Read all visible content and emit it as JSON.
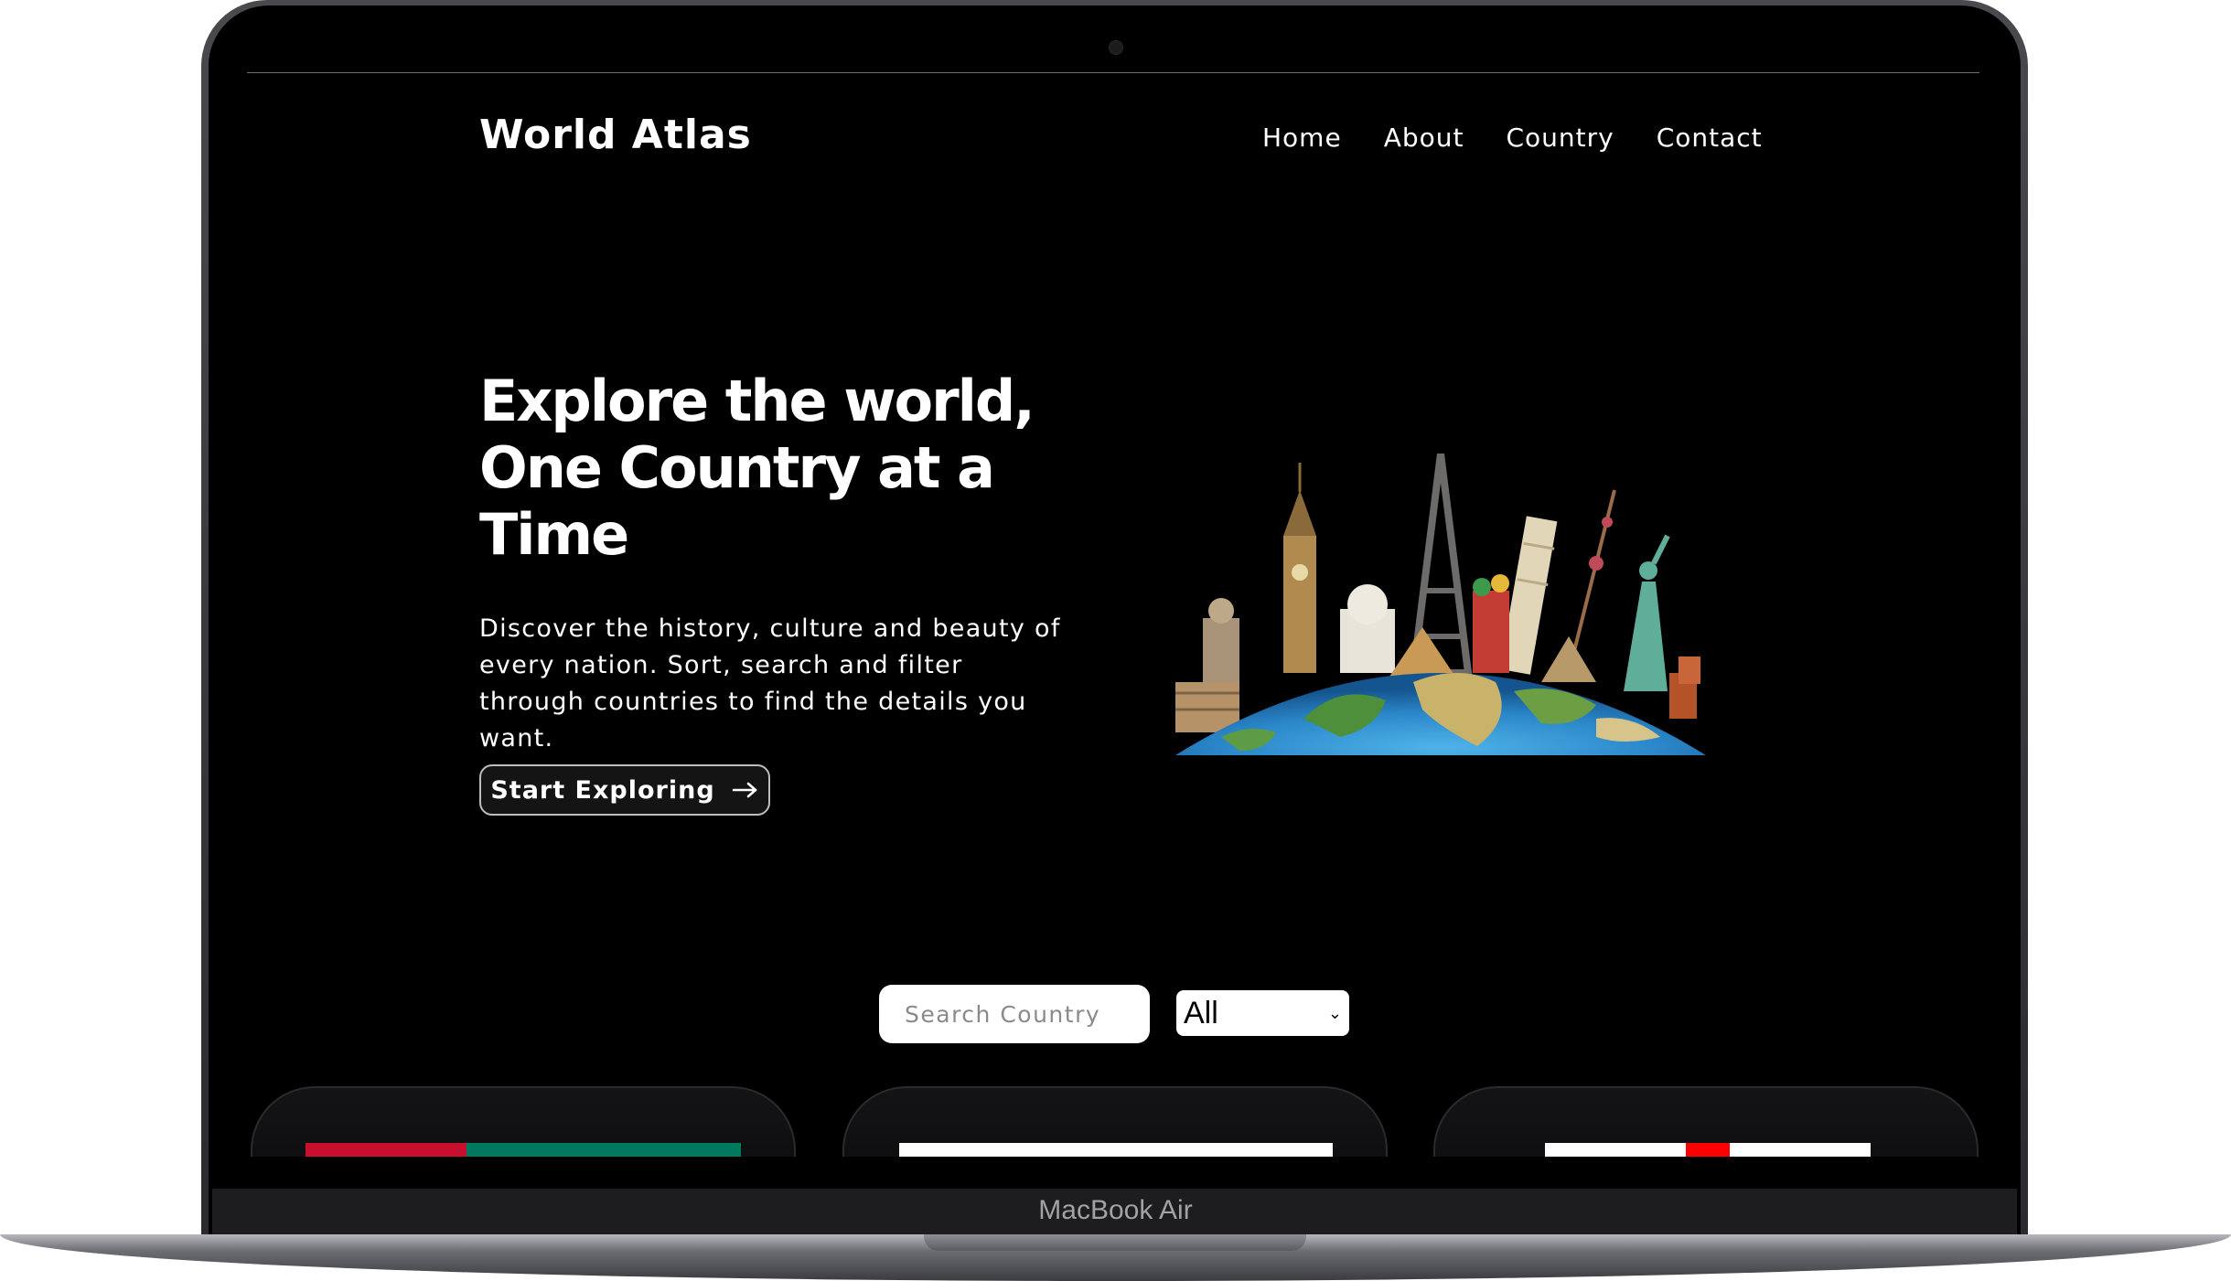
{
  "device": {
    "label": "MacBook Air"
  },
  "site": {
    "logo": "World Atlas",
    "nav": [
      "Home",
      "About",
      "Country",
      "Contact"
    ],
    "hero": {
      "title": "Explore the world, One Country at a Time",
      "description": "Discover the history, culture and beauty of every nation. Sort, search and filter through countries to find the details you want.",
      "cta_label": "Start Exploring"
    },
    "search": {
      "placeholder": "Search Country",
      "value": ""
    },
    "filter": {
      "selected": "All"
    },
    "colors": {
      "background": "#000000",
      "text": "#ffffff",
      "card": "#0f0e11"
    }
  }
}
